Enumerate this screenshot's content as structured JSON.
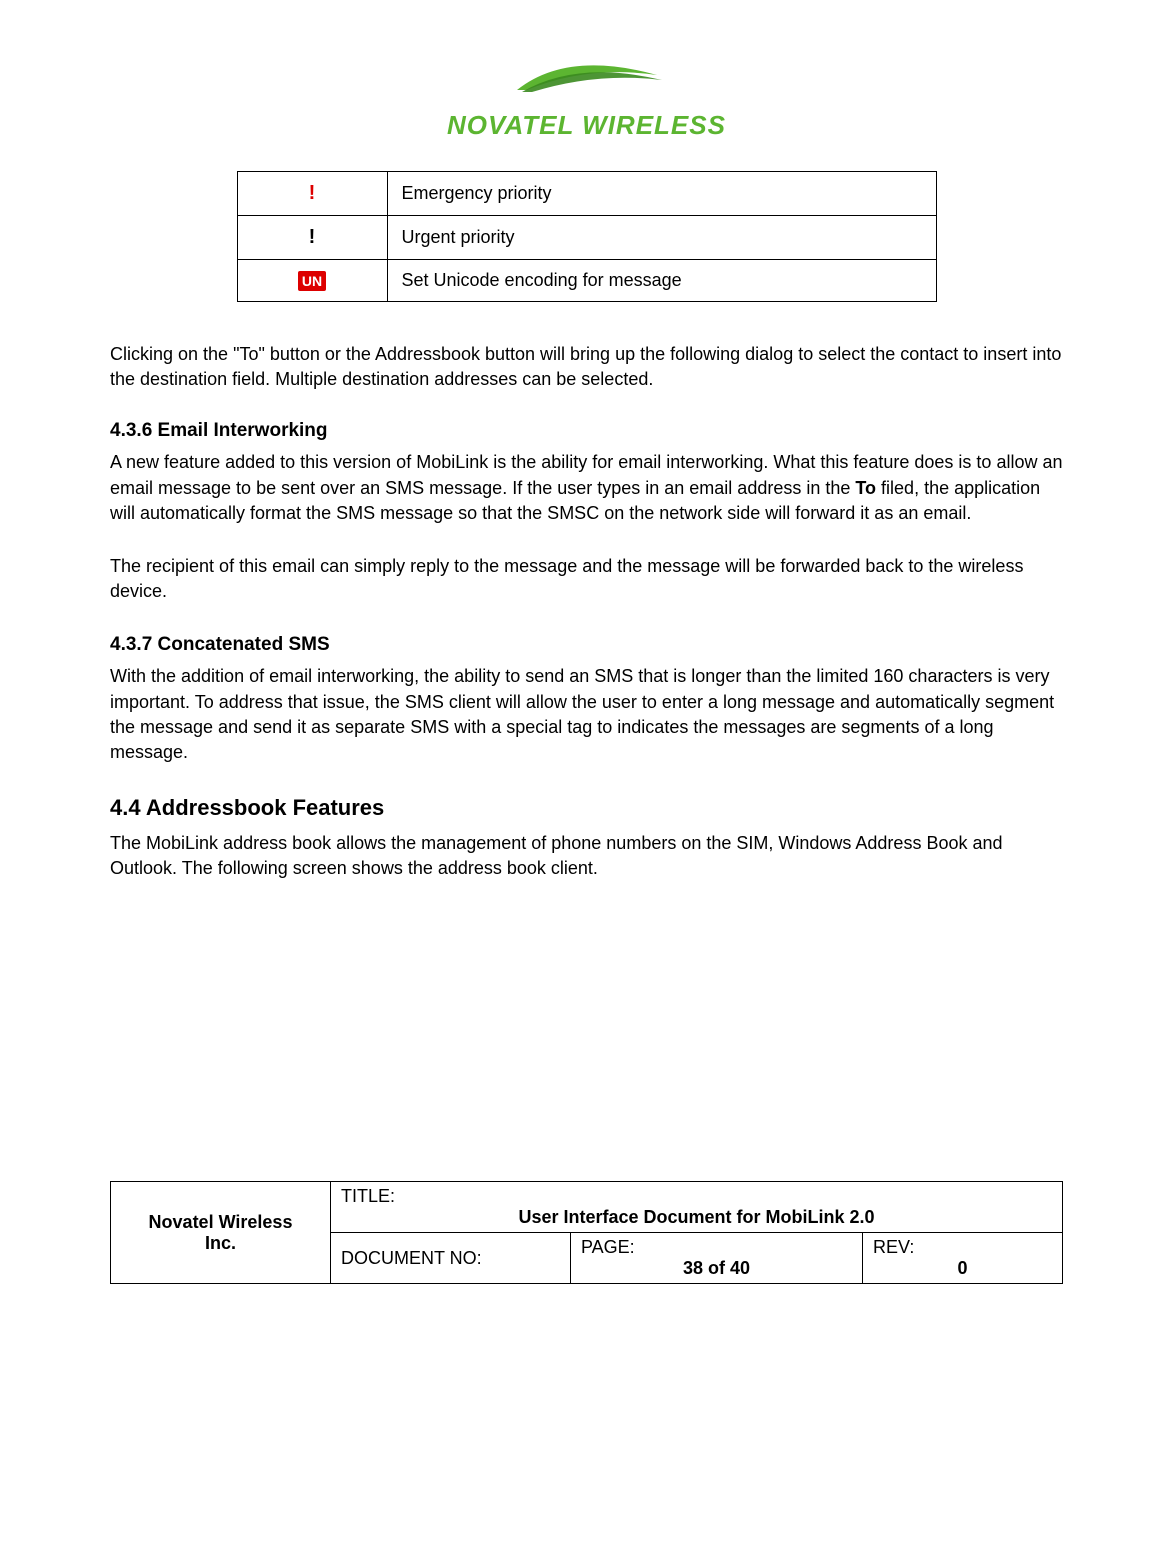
{
  "logo": {
    "text": "NOVATEL WIRELESS"
  },
  "icon_table": {
    "rows": [
      {
        "icon_name": "emergency-priority-icon",
        "glyph": "!",
        "glyph_class": "excl-red",
        "desc": "Emergency priority"
      },
      {
        "icon_name": "urgent-priority-icon",
        "glyph": "!",
        "glyph_class": "excl-black",
        "desc": "Urgent priority"
      },
      {
        "icon_name": "unicode-encoding-icon",
        "glyph": "UN",
        "glyph_class": "unicode-icon",
        "desc": "Set Unicode encoding for message"
      }
    ]
  },
  "paragraphs": {
    "intro": "Clicking on the \"To\" button or the Addressbook button will bring up the following dialog to select the contact to insert into the destination field.  Multiple destination addresses can be selected."
  },
  "sections": {
    "s436": {
      "heading": "4.3.6    Email Interworking",
      "p1_a": "A new feature added to this version of MobiLink is the ability for email interworking.  What this feature does is to allow an email message to be sent over an SMS message.  If the user types in an email address in the ",
      "p1_bold": "To",
      "p1_b": " filed, the application will automatically format the SMS message so that the SMSC on the network side will forward it as an email.",
      "p2": "The recipient of this email can simply reply to the message and the message will be forwarded back to the wireless device."
    },
    "s437": {
      "heading": "4.3.7    Concatenated SMS",
      "p1": "With the addition of email interworking, the ability to send an SMS that is longer than the limited 160 characters is very important.  To address that issue, the SMS client will allow the user to enter a long message and automatically segment the message and send it as separate SMS with a special tag to indicates the messages are segments of a long message."
    },
    "s44": {
      "heading": "4.4   Addressbook Features",
      "p1": "The MobiLink address book allows the management of phone numbers on the SIM, Windows Address Book and Outlook.  The following screen shows the address book client."
    }
  },
  "footer": {
    "company_line1": "Novatel Wireless",
    "company_line2": "Inc.",
    "title_label": "TITLE:",
    "title_value": "User Interface Document for MobiLink 2.0",
    "docno_label": "DOCUMENT NO:",
    "page_label": "PAGE:",
    "page_value": "38 of 40",
    "rev_label": "REV:",
    "rev_value": "0"
  }
}
